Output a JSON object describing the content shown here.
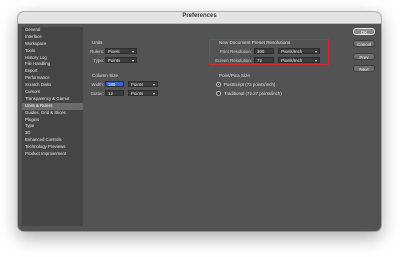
{
  "window": {
    "title": "Preferences"
  },
  "sidebar": {
    "items": [
      {
        "label": "General"
      },
      {
        "label": "Interface"
      },
      {
        "label": "Workspace"
      },
      {
        "label": "Tools"
      },
      {
        "label": "History Log"
      },
      {
        "label": "File Handling"
      },
      {
        "label": "Export"
      },
      {
        "label": "Performance"
      },
      {
        "label": "Scratch Disks"
      },
      {
        "label": "Cursors"
      },
      {
        "label": "Transparency & Gamut"
      },
      {
        "label": "Units & Rulers",
        "active": true
      },
      {
        "label": "Guides, Grid & Slices"
      },
      {
        "label": "Plugins"
      },
      {
        "label": "Type"
      },
      {
        "label": "3D"
      },
      {
        "label": "Enhanced Controls"
      },
      {
        "label": "Technology Previews"
      },
      {
        "label": "Product Improvement"
      }
    ]
  },
  "units": {
    "title": "Units",
    "rulers_label": "Rulers:",
    "rulers_value": "Pixels",
    "type_label": "Type:",
    "type_value": "Points"
  },
  "column_size": {
    "title": "Column Size",
    "width_label": "Width:",
    "width_value": "180",
    "width_unit": "Points",
    "gutter_label": "Gutter:",
    "gutter_value": "12",
    "gutter_unit": "Points"
  },
  "preset": {
    "title": "New Document Preset Resolutions",
    "print_label": "Print Resolution:",
    "print_value": "300",
    "print_unit": "Pixels/Inch",
    "screen_label": "Screen Resolution:",
    "screen_value": "72",
    "screen_unit": "Pixels/Inch",
    "highlight_color": "#d22a2a"
  },
  "point_pica": {
    "title": "Point/Pica Size",
    "options": [
      {
        "label": "PostScript (72 points/inch)",
        "selected": true
      },
      {
        "label": "Traditional (72.27 points/inch)",
        "selected": false
      }
    ]
  },
  "buttons": {
    "ok": "OK",
    "cancel": "Cancel",
    "prev": "Prev",
    "next": "Next"
  }
}
